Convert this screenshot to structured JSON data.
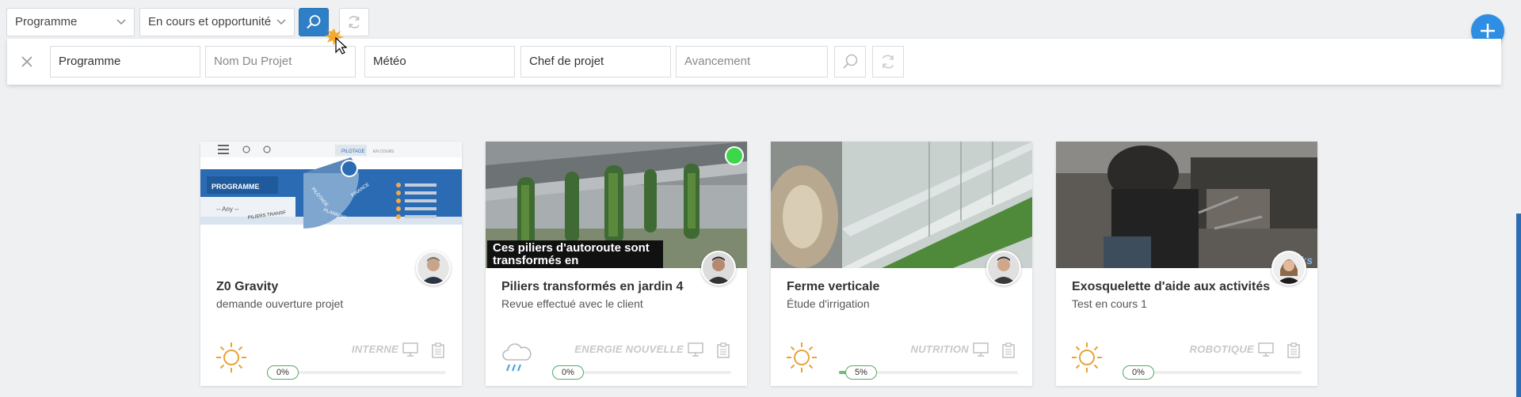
{
  "topbar": {
    "select_programme": "Programme",
    "select_status": "En cours et opportunité"
  },
  "filters": {
    "programme": {
      "value": "Programme",
      "placeholder": "Programme"
    },
    "nom_projet": {
      "placeholder": "Nom Du Projet"
    },
    "meteo": {
      "value": "Météo",
      "placeholder": "Météo"
    },
    "chef_projet": {
      "value": "Chef de projet",
      "placeholder": "Chef de projet"
    },
    "avancement": {
      "placeholder": "Avancement"
    }
  },
  "cards": [
    {
      "title": "Z0 Gravity",
      "subtitle": "demande ouverture projet",
      "category": "INTERNE",
      "weather": "sun-icon",
      "progress_label": "0%",
      "progress": 0
    },
    {
      "title": "Piliers transformés en jardin 4",
      "subtitle": "Revue effectué avec le client",
      "category": "ENERGIE NOUVELLE",
      "weather": "rain-cloud-icon",
      "progress_label": "0%",
      "progress": 0,
      "image_caption": "Ces piliers d'autoroute sont transformés en"
    },
    {
      "title": "Ferme verticale",
      "subtitle": "Étude d'irrigation",
      "category": "NUTRITION",
      "weather": "sun-icon",
      "progress_label": "5%",
      "progress": 5
    },
    {
      "title": "Exosquelette d'aide aux activités",
      "subtitle": "Test en cours 1",
      "category": "ROBOTIQUE",
      "weather": "sun-icon",
      "progress_label": "0%",
      "progress": 0,
      "image_tag": "eks"
    }
  ],
  "thumb1": {
    "menu_programme": "PROGRAMME",
    "any_label": "-- Any --",
    "tab_pilotage": "PILOTAGE",
    "tab_en_cours": "EN COURS",
    "wheel_pilotage": "PILOTAGE",
    "wheel_planning": "PLANNING",
    "wheel_finance": "FINANCE",
    "pilliers_label": "PILIERS TRANSF"
  },
  "colors": {
    "primary": "#2f7fc6",
    "fab": "#2d8ee3",
    "sun": "#e8a33a",
    "rain": "#4aa3df",
    "progress": "#55a967"
  }
}
